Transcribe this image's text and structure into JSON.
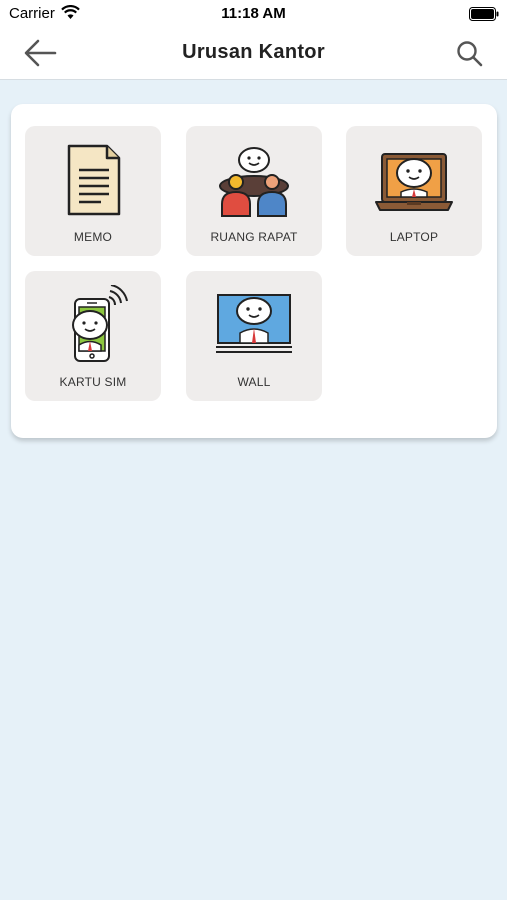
{
  "status_bar": {
    "carrier": "Carrier",
    "time": "11:18 AM"
  },
  "nav": {
    "title": "Urusan Kantor",
    "back_icon": "arrow-left-icon",
    "search_icon": "search-icon"
  },
  "grid": {
    "items": [
      {
        "label": "MEMO",
        "icon": "memo-document-icon"
      },
      {
        "label": "RUANG RAPAT",
        "icon": "meeting-room-icon"
      },
      {
        "label": "LAPTOP",
        "icon": "laptop-icon"
      },
      {
        "label": "KARTU SIM",
        "icon": "sim-card-phone-icon"
      },
      {
        "label": "WALL",
        "icon": "wall-screen-icon"
      }
    ]
  },
  "colors": {
    "background": "#e6f1f8",
    "tile": "#efedec",
    "card": "#ffffff"
  }
}
